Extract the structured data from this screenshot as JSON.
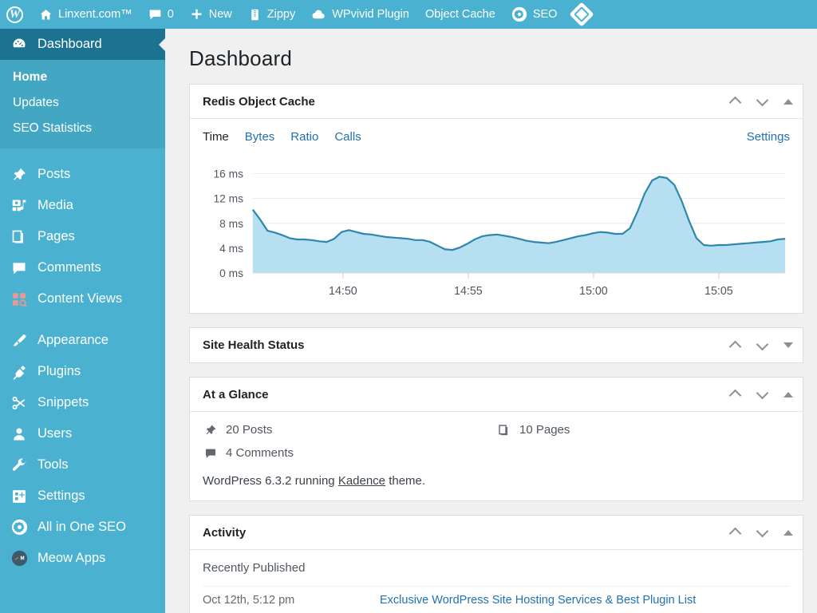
{
  "adminbar": {
    "wp_logo": "wordpress-logo-icon",
    "items": [
      {
        "icon": "home-icon",
        "label": "Linxent.com™"
      },
      {
        "icon": "comment-icon",
        "label": "0"
      },
      {
        "icon": "plus-icon",
        "label": "New"
      },
      {
        "icon": "zippy-icon",
        "label": "Zippy"
      },
      {
        "icon": "cloud-icon",
        "label": "WPvivid Plugin"
      },
      {
        "icon": "",
        "label": "Object Cache"
      },
      {
        "icon": "gear-circle-icon",
        "label": "SEO"
      },
      {
        "icon": "diamond-icon",
        "label": ""
      }
    ]
  },
  "sidebar": {
    "active_color": "#1b7391",
    "background_color": "#4ab2d0",
    "submenu_color": "#43a7c4",
    "items": [
      {
        "label": "Dashboard",
        "icon": "dashboard-icon",
        "current": true
      },
      {
        "label": "Posts",
        "icon": "pin-icon",
        "current": false
      },
      {
        "label": "Media",
        "icon": "media-icon",
        "current": false
      },
      {
        "label": "Pages",
        "icon": "pages-icon",
        "current": false
      },
      {
        "label": "Comments",
        "icon": "comment-icon",
        "current": false
      },
      {
        "label": "Content Views",
        "icon": "grid-view-icon",
        "current": false
      },
      {
        "label": "Appearance",
        "icon": "brush-icon",
        "current": false
      },
      {
        "label": "Plugins",
        "icon": "plug-icon",
        "current": false
      },
      {
        "label": "Snippets",
        "icon": "scissors-icon",
        "current": false
      },
      {
        "label": "Users",
        "icon": "user-icon",
        "current": false
      },
      {
        "label": "Tools",
        "icon": "wrench-icon",
        "current": false
      },
      {
        "label": "Settings",
        "icon": "settings-icon",
        "current": false
      },
      {
        "label": "All in One SEO",
        "icon": "aioseo-icon",
        "current": false
      },
      {
        "label": "Meow Apps",
        "icon": "meow-apps-icon",
        "current": false
      }
    ],
    "submenu": [
      {
        "label": "Home",
        "current": true
      },
      {
        "label": "Updates",
        "current": false
      },
      {
        "label": "SEO Statistics",
        "current": false
      }
    ]
  },
  "page": {
    "title": "Dashboard"
  },
  "widgets": {
    "redis": {
      "title": "Redis Object Cache",
      "tabs": [
        {
          "label": "Time",
          "active": true
        },
        {
          "label": "Bytes",
          "active": false
        },
        {
          "label": "Ratio",
          "active": false
        },
        {
          "label": "Calls",
          "active": false
        }
      ],
      "settings_label": "Settings",
      "collapse_state": "expanded"
    },
    "site_health": {
      "title": "Site Health Status",
      "collapse_state": "collapsed"
    },
    "at_a_glance": {
      "title": "At a Glance",
      "collapse_state": "expanded",
      "counts": [
        {
          "icon": "pin-icon",
          "label": "20 Posts"
        },
        {
          "icon": "pages-icon",
          "label": "10 Pages"
        },
        {
          "icon": "comment-icon",
          "label": "4 Comments"
        }
      ],
      "version_prefix": "WordPress 6.3.2 running ",
      "theme_name": "Kadence",
      "version_suffix": " theme."
    },
    "activity": {
      "title": "Activity",
      "collapse_state": "expanded",
      "section_label": "Recently Published",
      "rows": [
        {
          "date": "Oct 12th, 5:12 pm",
          "title": "Exclusive WordPress Site Hosting Services & Best Plugin List"
        }
      ]
    }
  },
  "chart_data": {
    "type": "area",
    "title": "Redis Object Cache — Time",
    "xlabel": "",
    "ylabel": "ms",
    "ylim": [
      0,
      18
    ],
    "yticks": [
      0,
      4,
      8,
      12,
      16
    ],
    "ytick_labels": [
      "0 ms",
      "4 ms",
      "8 ms",
      "12 ms",
      "16 ms"
    ],
    "xticks": [
      "14:50",
      "14:55",
      "15:00",
      "15:05"
    ],
    "grid": true,
    "legend": "none",
    "line_color": "#2e86ab",
    "fill_color": "#b6e0f2",
    "series": [
      {
        "name": "Time (ms)",
        "values": [
          10.2,
          8.6,
          6.8,
          6.5,
          6.1,
          5.6,
          5.4,
          5.4,
          5.3,
          5.1,
          5.0,
          5.5,
          6.6,
          6.9,
          6.6,
          6.3,
          6.2,
          6.0,
          5.8,
          5.7,
          5.6,
          5.5,
          5.3,
          5.3,
          5.0,
          4.4,
          3.8,
          3.7,
          4.1,
          4.7,
          5.4,
          5.9,
          6.1,
          6.2,
          6.0,
          5.8,
          5.5,
          5.2,
          5.0,
          4.9,
          4.8,
          5.0,
          5.3,
          5.6,
          5.9,
          6.1,
          6.4,
          6.6,
          6.5,
          6.3,
          6.3,
          7.2,
          9.8,
          12.8,
          14.9,
          15.5,
          15.3,
          14.2,
          11.6,
          8.4,
          5.6,
          4.5,
          4.4,
          4.5,
          4.5,
          4.6,
          4.7,
          4.8,
          4.9,
          5.0,
          5.1,
          5.4,
          5.5
        ]
      }
    ]
  }
}
